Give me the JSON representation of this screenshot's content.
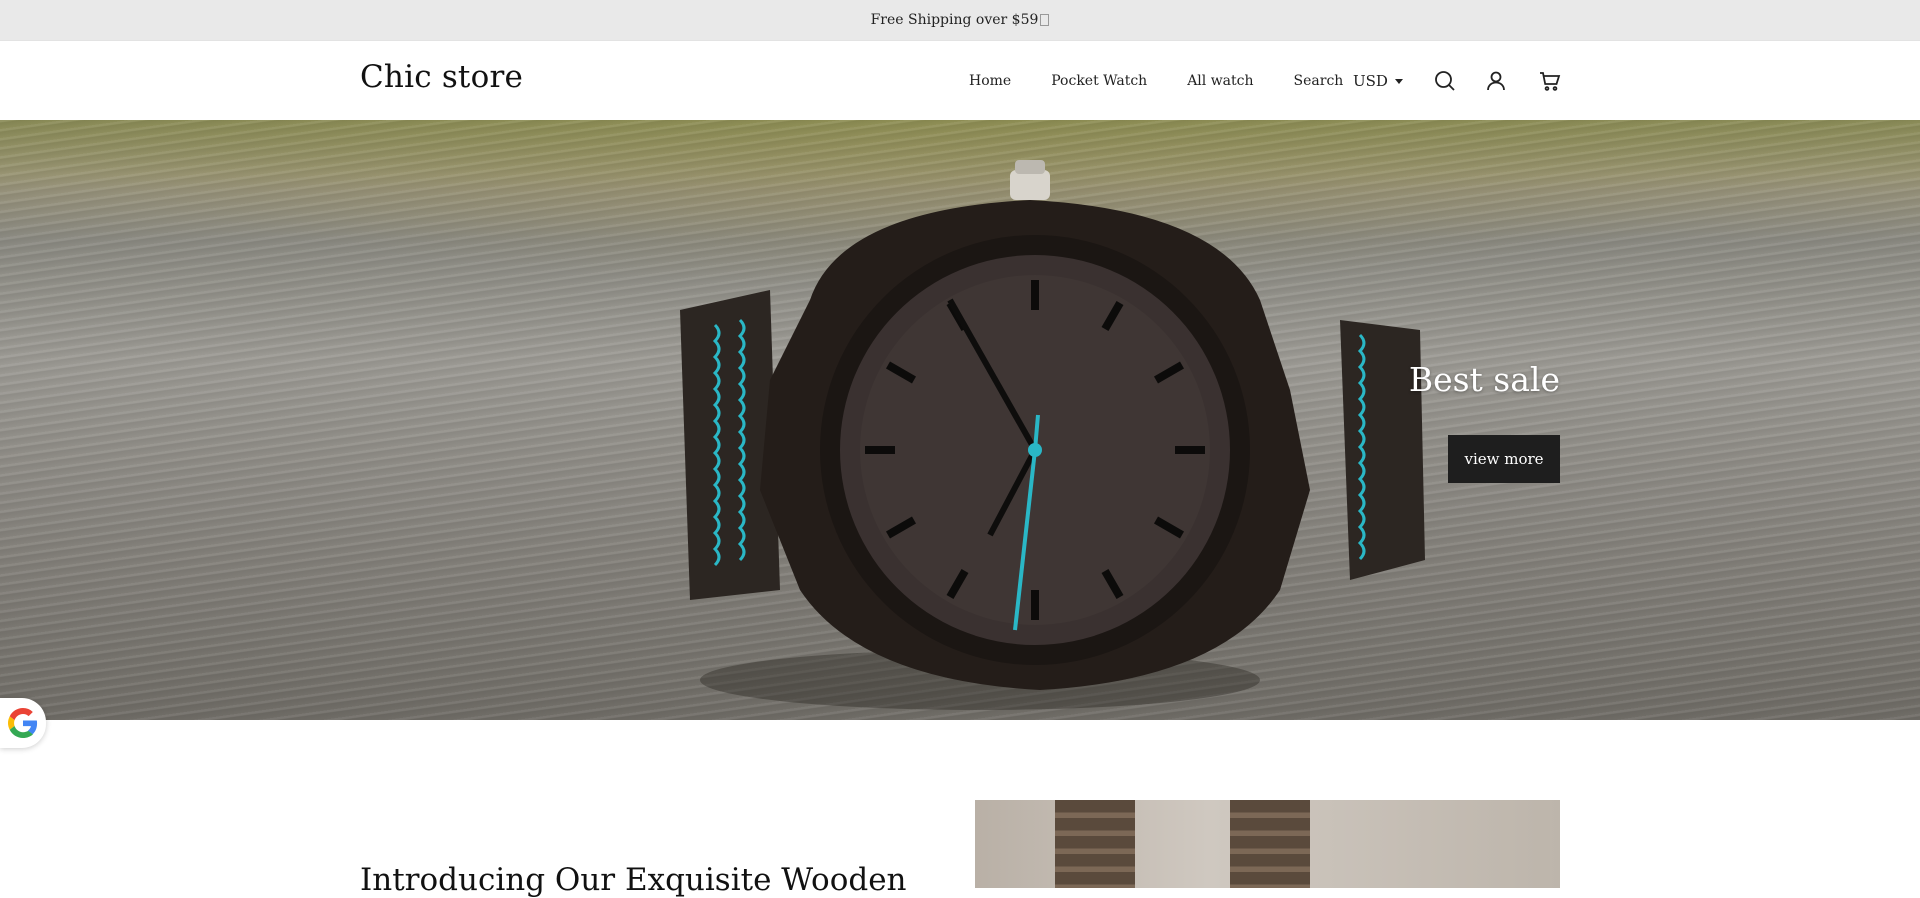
{
  "announcement": {
    "text": "Free Shipping over $59"
  },
  "header": {
    "brand": "Chic store",
    "nav": [
      {
        "label": "Home"
      },
      {
        "label": "Pocket Watch"
      },
      {
        "label": "All watch"
      },
      {
        "label": "Search"
      }
    ],
    "currency": "USD",
    "icons": [
      "search-icon",
      "account-icon",
      "cart-icon"
    ]
  },
  "hero": {
    "title": "Best sale",
    "button_label": "view more"
  },
  "intro": {
    "title": "Introducing Our Exquisite Wooden"
  },
  "floating": {
    "badge_icon": "google-icon"
  },
  "colors": {
    "announcement_bg": "#e9e9e9",
    "button_bg": "#1e1e1e",
    "accent_hand": "#2ab7c6"
  }
}
